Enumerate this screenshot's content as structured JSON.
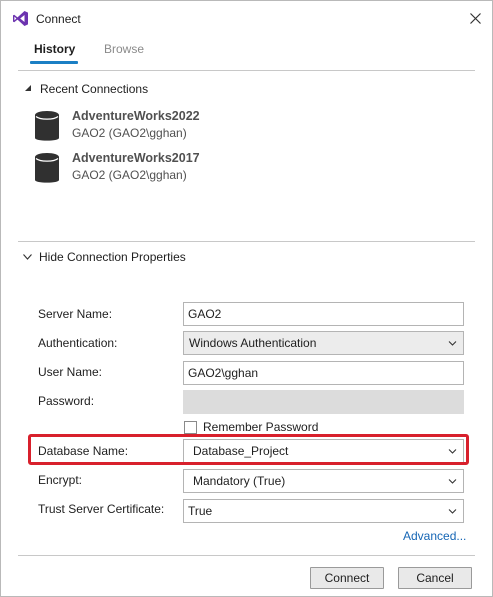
{
  "window": {
    "title": "Connect"
  },
  "tabs": [
    {
      "label": "History",
      "active": true
    },
    {
      "label": "Browse",
      "active": false
    }
  ],
  "recent": {
    "header": "Recent Connections",
    "items": [
      {
        "name": "AdventureWorks2022",
        "server": "GAO2 (GAO2\\gghan)"
      },
      {
        "name": "AdventureWorks2017",
        "server": "GAO2 (GAO2\\gghan)"
      }
    ]
  },
  "properties": {
    "header": "Hide Connection Properties",
    "server_name_label": "Server Name:",
    "server_name_value": "GAO2",
    "authentication_label": "Authentication:",
    "authentication_value": "Windows Authentication",
    "user_name_label": "User Name:",
    "user_name_value": "GAO2\\gghan",
    "password_label": "Password:",
    "password_value": "",
    "remember_password_label": "Remember Password",
    "remember_password_checked": false,
    "database_name_label": "Database Name:",
    "database_name_value": "Database_Project",
    "encrypt_label": "Encrypt:",
    "encrypt_value": "Mandatory (True)",
    "trust_cert_label": "Trust Server Certificate:",
    "trust_cert_value": "True"
  },
  "advanced_link": "Advanced...",
  "buttons": {
    "connect": "Connect",
    "cancel": "Cancel"
  },
  "colors": {
    "accent": "#1b7fc4",
    "highlight": "#d8202c",
    "link": "#1666b5",
    "vs_purple": "#6c33af"
  }
}
